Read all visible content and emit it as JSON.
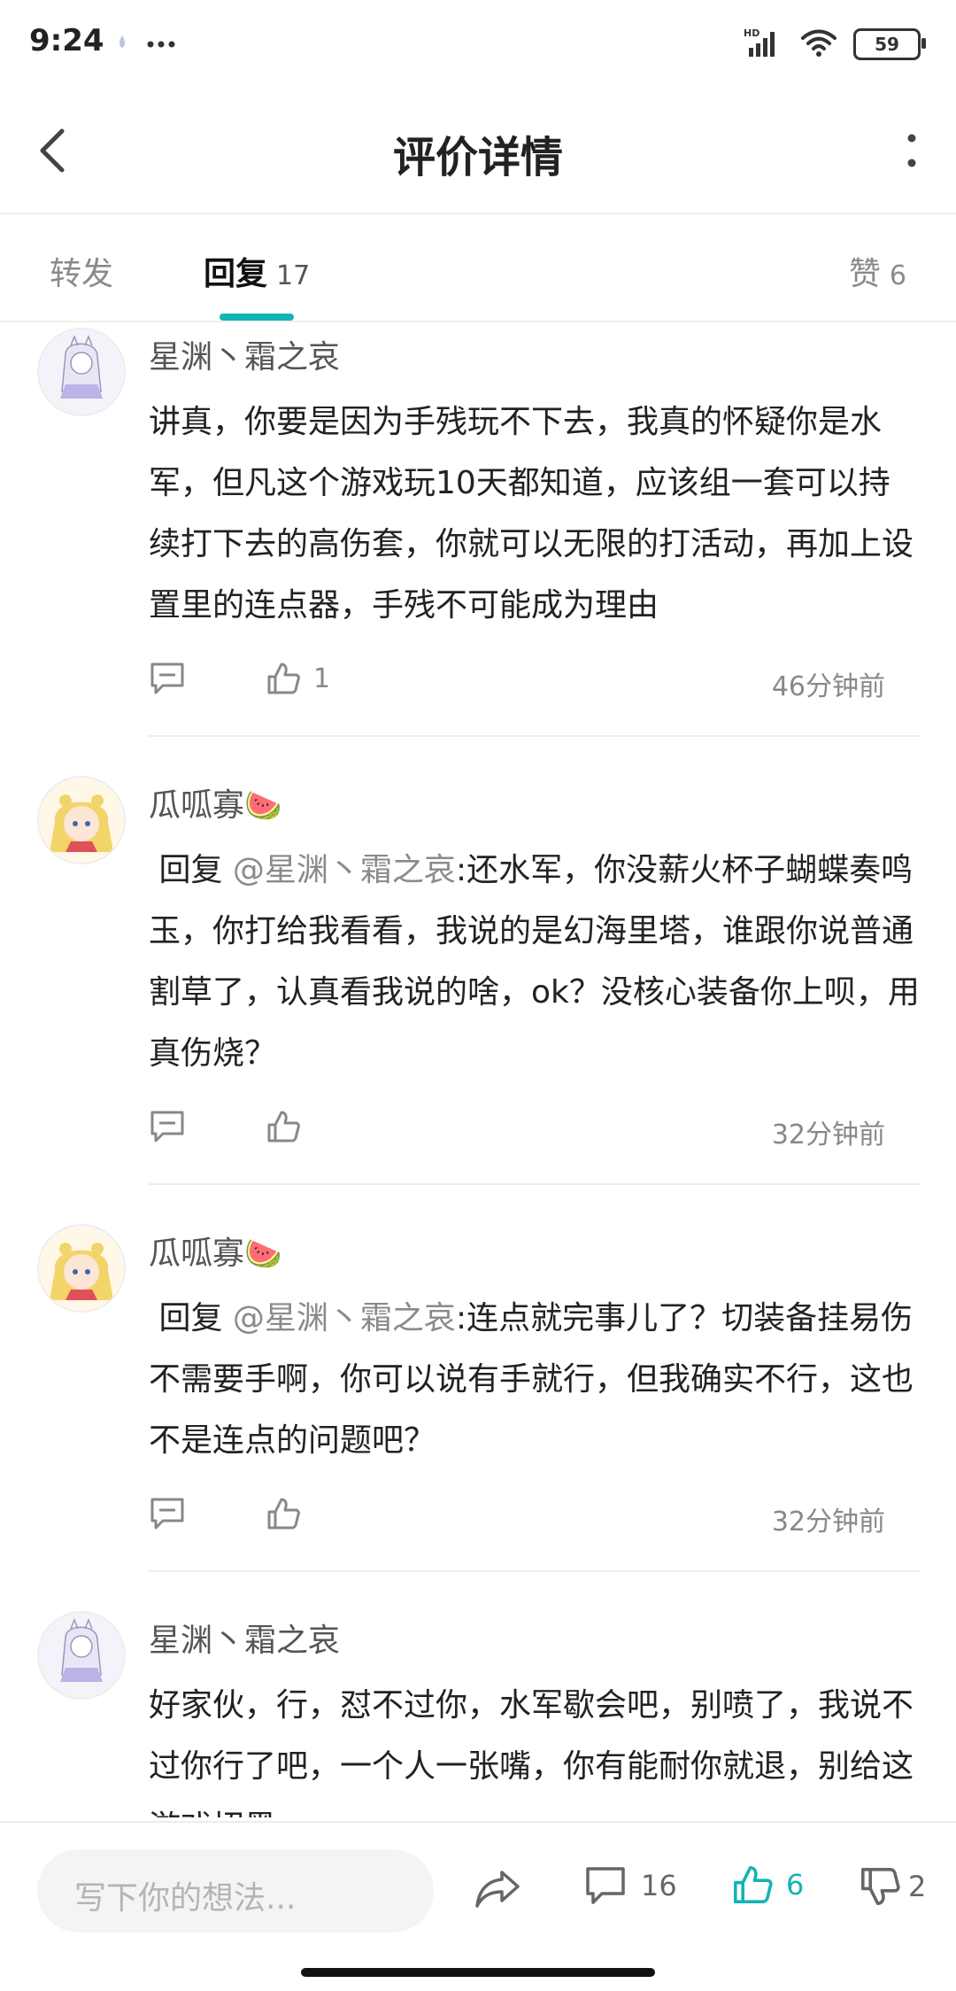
{
  "status_bar": {
    "time": "9:24",
    "battery": "59"
  },
  "header": {
    "title": "评价详情"
  },
  "tabs": {
    "repost": {
      "label": "转发"
    },
    "reply": {
      "label": "回复",
      "count": "17"
    },
    "like": {
      "label": "赞",
      "count": "6"
    }
  },
  "comments": [
    {
      "username": "星渊丶霜之哀",
      "emoji": "",
      "body": "讲真，你要是因为手残玩不下去，我真的怀疑你是水军，但凡这个游戏玩10天都知道，应该组一套可以持续打下去的高伤套，你就可以无限的打活动，再加上设置里的连点器，手残不可能成为理由",
      "likes": "1",
      "time": "46分钟前"
    },
    {
      "username": "瓜呱寡",
      "emoji": "🍉",
      "reply_prefix": "回复",
      "mention": "@星渊丶霜之哀",
      "body": ":还水军，你没薪火杯子蝴蝶奏鸣玉，你打给我看看，我说的是幻海里塔，谁跟你说普通割草了，认真看我说的啥，ok？没核心装备你上呗，用真伤烧？",
      "likes": "",
      "time": "32分钟前"
    },
    {
      "username": "瓜呱寡",
      "emoji": "🍉",
      "reply_prefix": "回复",
      "mention": "@星渊丶霜之哀",
      "body": ":连点就完事儿了？切装备挂易伤不需要手啊，你可以说有手就行，但我确实不行，这也不是连点的问题吧？",
      "likes": "",
      "time": "32分钟前"
    },
    {
      "username": "星渊丶霜之哀",
      "emoji": "",
      "body": "好家伙，行，怼不过你，水军歇会吧，别喷了，我说不过你行了吧，一个人一张嘴，你有能耐你就退，别给这游戏招黑",
      "likes": "",
      "time": ""
    }
  ],
  "bottom_bar": {
    "input_placeholder": "写下你的想法...",
    "comment_count": "16",
    "like_count": "6",
    "dislike_count": "2"
  },
  "colors": {
    "accent": "#14b4b4",
    "muted": "#888888"
  }
}
